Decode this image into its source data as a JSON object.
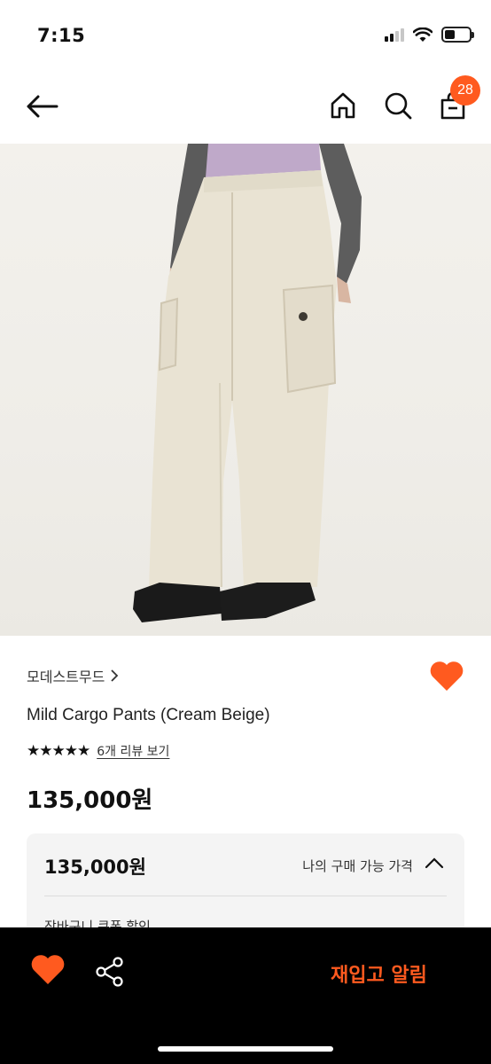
{
  "status_bar": {
    "time": "7:15"
  },
  "header": {
    "cart_count": "28"
  },
  "product": {
    "brand": "모데스트무드",
    "name": "Mild Cargo Pants (Cream Beige)",
    "rating_stars": "★★★★★",
    "rating_value": 5,
    "review_link": "6개 리뷰 보기",
    "price": "135,000원"
  },
  "price_box": {
    "price": "135,000원",
    "label": "나의 구매 가능 가격",
    "sub_label": "장바구니 쿠폰 할인"
  },
  "bottom_bar": {
    "restock_label": "재입고 알림"
  },
  "colors": {
    "accent": "#ff5a1f",
    "bar": "#000000"
  },
  "icons": [
    "back-arrow-icon",
    "home-icon",
    "search-icon",
    "cart-icon",
    "heart-icon",
    "share-icon",
    "chevron-up-icon"
  ]
}
